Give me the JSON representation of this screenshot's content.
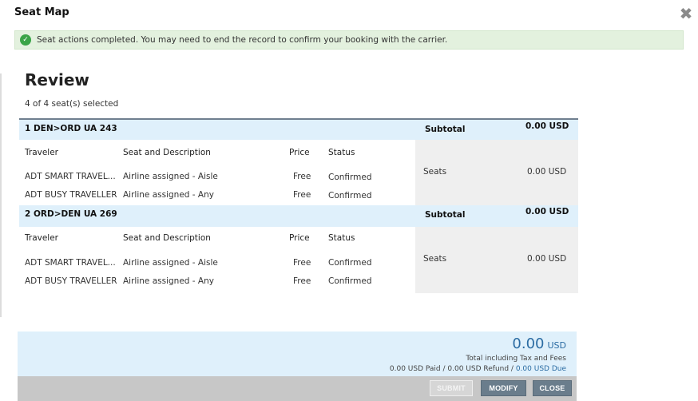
{
  "dialog": {
    "title": "Seat Map",
    "close_glyph": "✖"
  },
  "alert": {
    "icon": "check-circle-icon",
    "message": "Seat actions completed. You may need to end the record to confirm your booking with the carrier."
  },
  "review": {
    "title": "Review",
    "seat_count": "4 of 4 seat(s) selected"
  },
  "columns": {
    "traveler": "Traveler",
    "seat": "Seat and Description",
    "price": "Price",
    "status": "Status"
  },
  "segments": [
    {
      "label": "1 DEN>ORD UA 243",
      "subtotal_label": "Subtotal",
      "subtotal": "0.00 USD",
      "seats_label": "Seats",
      "seats_amount": "0.00 USD",
      "rows": [
        {
          "traveler": "ADT SMART TRAVEL...",
          "seat": "Airline assigned - Aisle",
          "price": "Free",
          "status": "Confirmed"
        },
        {
          "traveler": "ADT BUSY TRAVELLER",
          "seat": "Airline assigned - Any",
          "price": "Free",
          "status": "Confirmed"
        }
      ]
    },
    {
      "label": "2 ORD>DEN UA 269",
      "subtotal_label": "Subtotal",
      "subtotal": "0.00 USD",
      "seats_label": "Seats",
      "seats_amount": "0.00 USD",
      "rows": [
        {
          "traveler": "ADT SMART TRAVEL...",
          "seat": "Airline assigned - Aisle",
          "price": "Free",
          "status": "Confirmed"
        },
        {
          "traveler": "ADT BUSY TRAVELLER",
          "seat": "Airline assigned - Any",
          "price": "Free",
          "status": "Confirmed"
        }
      ]
    }
  ],
  "total": {
    "amount": "0.00",
    "currency": "USD",
    "note": "Total including Tax and Fees",
    "paid_refund": "0.00 USD Paid / 0.00 USD Refund / ",
    "due": "0.00 USD Due"
  },
  "buttons": {
    "submit": "SUBMIT",
    "modify": "MODIFY",
    "close": "CLOSE"
  },
  "colors": {
    "accent": "#2b6ca3",
    "header_bg": "#dff0fb",
    "success_bg": "#e3f1de",
    "button": "#6a7d8c"
  }
}
